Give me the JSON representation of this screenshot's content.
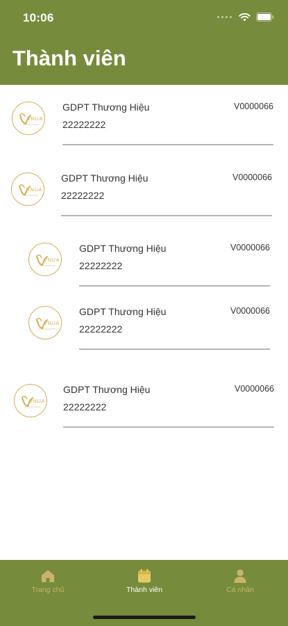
{
  "status_bar": {
    "time": "10:06"
  },
  "header": {
    "title": "Thành viên"
  },
  "logo": {
    "brand": "VNUA",
    "color": "#d4ad55"
  },
  "members": [
    {
      "name": "GDPT Thương Hiệu",
      "phone": "22222222",
      "code": "V0000066"
    },
    {
      "name": "GDPT Thương Hiệu",
      "phone": "22222222",
      "code": "V0000066"
    },
    {
      "name": "GDPT Thương Hiệu",
      "phone": "22222222",
      "code": "V0000066"
    },
    {
      "name": "GDPT Thương Hiệu",
      "phone": "22222222",
      "code": "V0000066"
    },
    {
      "name": "GDPT Thương Hiệu",
      "phone": "22222222",
      "code": "V0000066"
    }
  ],
  "tabbar": {
    "tabs": [
      {
        "label": "Trang chủ",
        "icon": "home-icon"
      },
      {
        "label": "Thành viên",
        "icon": "calendar-icon",
        "active": true
      },
      {
        "label": "Cá nhân",
        "icon": "person-icon"
      }
    ]
  },
  "colors": {
    "primary": "#768c3c",
    "accent": "#d4ad55",
    "tab_inactive": "#c7b46a"
  }
}
